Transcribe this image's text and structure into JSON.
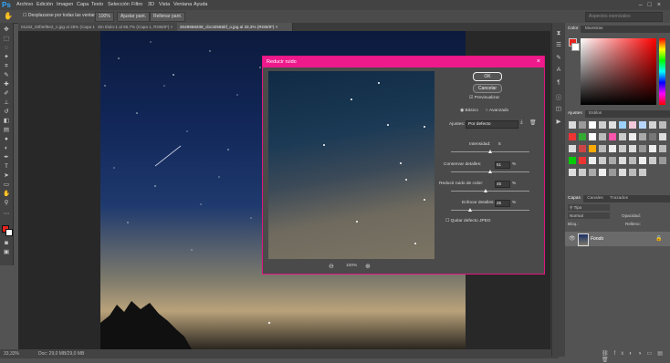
{
  "app": {
    "logo": "Ps"
  },
  "menu": [
    "Archivo",
    "Edición",
    "Imagen",
    "Capa",
    "Texto",
    "Selección",
    "Filtro",
    "3D",
    "Vista",
    "Ventana",
    "Ayuda"
  ],
  "options_bar": {
    "tool_icon": "hand-icon",
    "scroll_all": "Desplazarse por todas las ventanas",
    "zoom": "100%",
    "fit_screen": "Ajustar pant.",
    "fill_screen": "Rellenar pant.",
    "search_placeholder": "Aspectos esenciales"
  },
  "tabs": [
    {
      "label": "01162_03f3ef9e2_n.jpg al 25% (Capa 1, RGB/8*) ×",
      "active": false
    },
    {
      "label": "Sin título-1 al 66,7% (Capa 1, RGB/8*) ×",
      "active": false
    },
    {
      "label": "2049958208_cbc32565bf_o.jpg al 33,3% (RGB/8*) ×",
      "active": true
    }
  ],
  "status": {
    "zoom": "33,33%",
    "doc": "Doc: 29,0 MB/29,0 MB"
  },
  "panels": {
    "color_tabs": [
      "Color",
      "Muestras"
    ],
    "adjust_tabs": [
      "Ajustes",
      "Estilos"
    ],
    "layers_tabs": [
      "Capas",
      "Canales",
      "Trazados"
    ],
    "layers_kind": "Tipo",
    "blend_mode": "Normal",
    "opacity_label": "Opacidad:",
    "lock_label": "Bloq.:",
    "fill_label": "Relleno:",
    "layer_name": "Fondo"
  },
  "dialog": {
    "title": "Reducir ruido",
    "ok": "OK",
    "cancel": "Cancelar",
    "preview": "Previsualizar",
    "mode_basic": "Básico",
    "mode_advanced": "Avanzado",
    "settings_label": "Ajustes:",
    "settings_value": "Por defecto",
    "strength_label": "Intensidad:",
    "strength_value": "5",
    "preserve_label": "Conservar detalles:",
    "preserve_value": "51",
    "color_noise_label": "Reducir ruido de color:",
    "color_noise_value": "45",
    "sharpen_label": "Enfocar detalles:",
    "sharpen_value": "25",
    "pct": "%",
    "jpeg_label": "Quitar defecto JPEG",
    "zoom": "100%"
  },
  "sliders": {
    "strength": 0.5,
    "preserve": 0.51,
    "color_noise": 0.45,
    "sharpen": 0.25
  },
  "colors": {
    "accent": "#ee1a8c",
    "foreground": "#e8241e",
    "background": "#ffffff"
  }
}
